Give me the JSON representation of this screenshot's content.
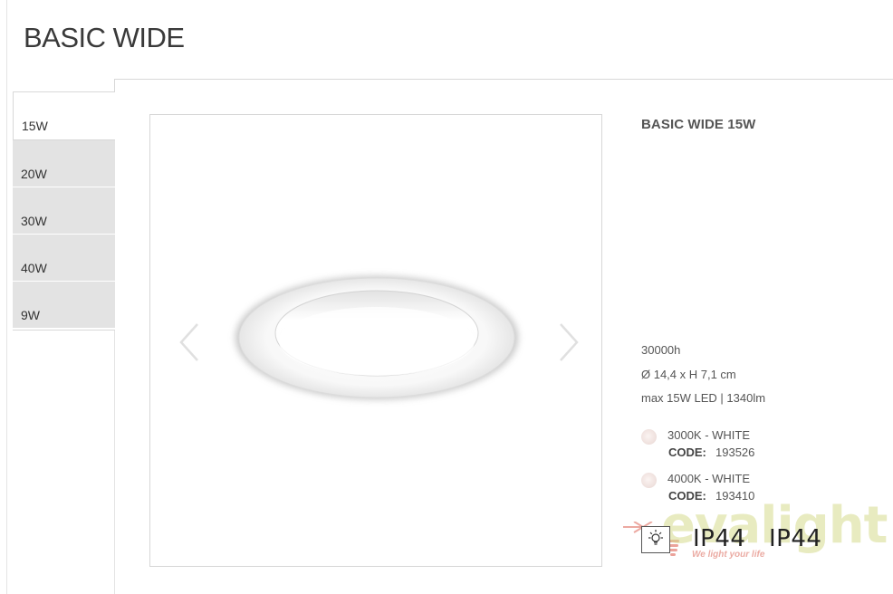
{
  "page": {
    "title": "BASIC WIDE"
  },
  "tabs": [
    {
      "label": "15W",
      "active": true
    },
    {
      "label": "20W",
      "active": false
    },
    {
      "label": "30W",
      "active": false
    },
    {
      "label": "40W",
      "active": false
    },
    {
      "label": "9W",
      "active": false
    }
  ],
  "product": {
    "title": "BASIC WIDE 15W",
    "specs": {
      "lifetime": "30000h",
      "dimensions": "Ø 14,4 x H 7,1 cm",
      "power": "max 15W LED | 1340lm"
    },
    "variants": [
      {
        "name": "3000K - WHITE",
        "code_label": "CODE:",
        "code": "193526"
      },
      {
        "name": "4000K - WHITE",
        "code_label": "CODE:",
        "code": "193410"
      }
    ],
    "ratings": [
      "IP44",
      "IP44"
    ]
  },
  "gallery": {
    "prev_icon": "chevron-left-icon",
    "next_icon": "chevron-right-icon"
  },
  "watermark": {
    "brand": "evalight",
    "tagline": "We light your life"
  },
  "colors": {
    "tab_inactive": "#e3e3e3",
    "text": "#555555",
    "watermark": "#d5db8c"
  }
}
